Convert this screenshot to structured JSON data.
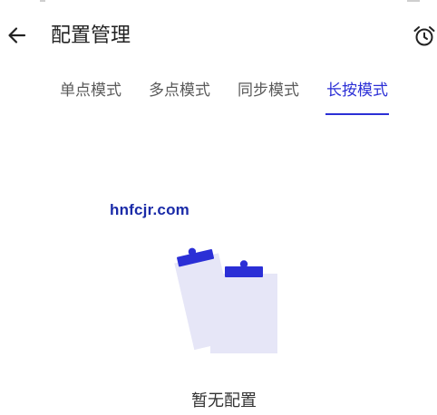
{
  "header": {
    "title": "配置管理",
    "back_icon": "arrow-left-icon",
    "alarm_icon": "alarm-clock-icon"
  },
  "tabs": [
    {
      "label": "单点模式",
      "selected": false
    },
    {
      "label": "多点模式",
      "selected": false
    },
    {
      "label": "同步模式",
      "selected": false
    },
    {
      "label": "长按模式",
      "selected": true
    }
  ],
  "watermark": "hnfcjr.com",
  "empty_state": {
    "message": "暂无配置",
    "illustration": "empty-clipboard-icon"
  },
  "colors": {
    "accent": "#2b2fd6",
    "text": "#222222",
    "tab_inactive": "#5a5a5a",
    "illustration_light": "#e6e6f7"
  }
}
